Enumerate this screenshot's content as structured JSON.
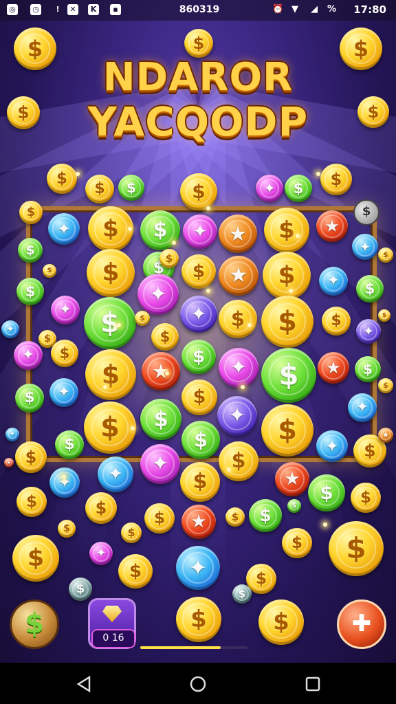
{
  "status_bar": {
    "left_icons": [
      "notification-icon",
      "timer-icon",
      "alert-icon",
      "settings-icon",
      "message-icon",
      "app-icon"
    ],
    "center_text": "860319",
    "battery_text": "%",
    "time": "17:80"
  },
  "title": {
    "line1": "NDAROR",
    "line2": "YACQODP"
  },
  "board": {
    "corner_badge": "$"
  },
  "coin_symbol": "$",
  "hud": {
    "gem_count": "0 16",
    "progress": 0.75,
    "left_button_icon": "dollar-icon",
    "right_button_icon": "hammer-icon"
  },
  "nav": {
    "back": "back-icon",
    "home": "home-icon",
    "recents": "recents-icon"
  },
  "colors": {
    "gold": "#ffd52e",
    "green": "#6ee03a",
    "pink": "#e84ae8",
    "blue": "#3ab4f4",
    "red": "#f04a20",
    "frame": "#b07838",
    "background": "#3a2680"
  }
}
